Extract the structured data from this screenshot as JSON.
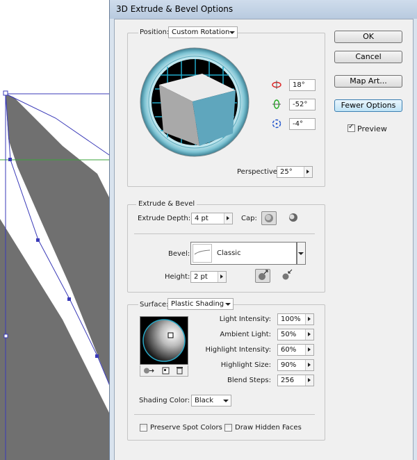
{
  "dialog": {
    "title": "3D Extrude & Bevel Options",
    "buttons": {
      "ok": "OK",
      "cancel": "Cancel",
      "map_art": "Map Art...",
      "fewer_options": "Fewer Options"
    },
    "preview": {
      "label": "Preview",
      "checked": true
    }
  },
  "position": {
    "label": "Position:",
    "value": "Custom Rotation",
    "rotation_x": "18°",
    "rotation_y": "-52°",
    "rotation_z": "-4°",
    "perspective_label": "Perspective:",
    "perspective_value": "25°"
  },
  "extrude": {
    "section_label": "Extrude & Bevel",
    "depth_label": "Extrude Depth:",
    "depth_value": "4 pt",
    "cap_label": "Cap:",
    "bevel_label": "Bevel:",
    "bevel_value": "Classic",
    "height_label": "Height:",
    "height_value": "2 pt"
  },
  "surface": {
    "label": "Surface:",
    "value": "Plastic Shading",
    "light_intensity_label": "Light Intensity:",
    "light_intensity": "100%",
    "ambient_light_label": "Ambient Light:",
    "ambient_light": "50%",
    "highlight_intensity_label": "Highlight Intensity:",
    "highlight_intensity": "60%",
    "highlight_size_label": "Highlight Size:",
    "highlight_size": "90%",
    "blend_steps_label": "Blend Steps:",
    "blend_steps": "256",
    "shading_color_label": "Shading Color:",
    "shading_color": "Black",
    "preserve_spot_colors": "Preserve Spot Colors",
    "draw_hidden_faces": "Draw Hidden Faces"
  },
  "colors": {
    "cube_front": "#a9a9a9",
    "cube_side": "#5fa6bd",
    "cube_top": "#ececec",
    "grid": "#21a9c9",
    "artwork_fill": "#707070",
    "path_stroke": "#3a3ab8",
    "guide_line": "#3aa33a"
  }
}
